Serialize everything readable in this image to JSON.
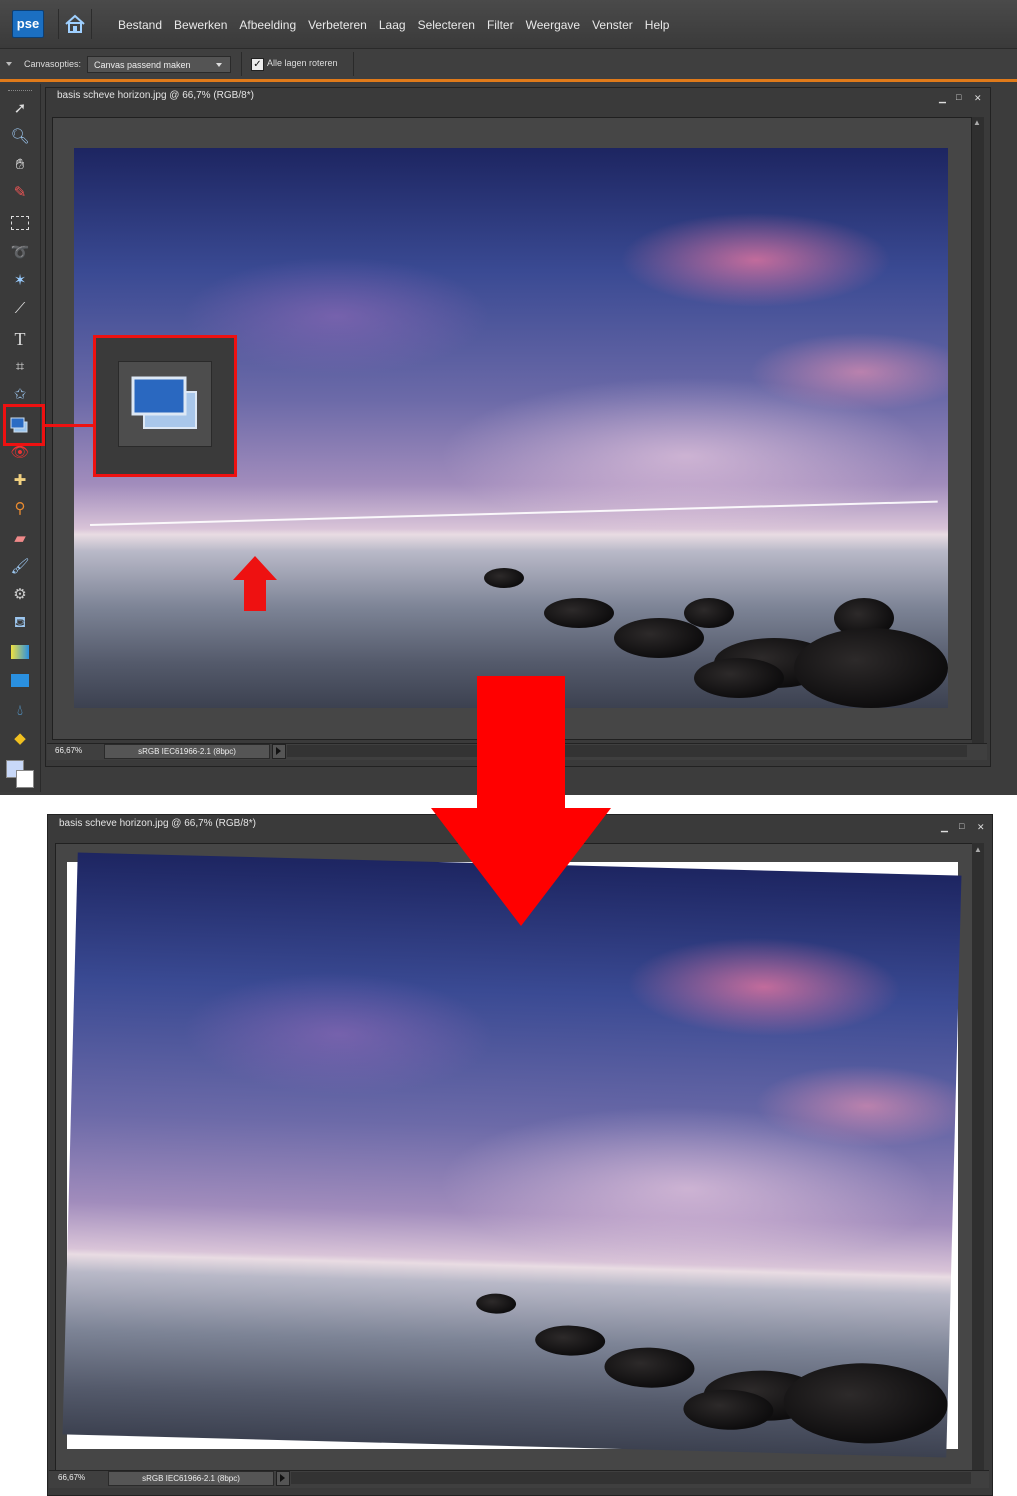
{
  "app": {
    "logo_text": "pse",
    "home_icon": "home-icon"
  },
  "menu": [
    "Bestand",
    "Bewerken",
    "Afbeelding",
    "Verbeteren",
    "Laag",
    "Selecteren",
    "Filter",
    "Weergave",
    "Venster",
    "Help"
  ],
  "options_bar": {
    "canvas_label": "Canvasopties:",
    "canvas_select_value": "Canvas passend maken",
    "rotate_all_layers_label": "Alle lagen roteren",
    "rotate_all_layers_checked": true
  },
  "tools": [
    "move-tool-icon",
    "zoom-tool-icon",
    "hand-tool-icon",
    "eyedropper-tool-icon",
    "marquee-tool-icon",
    "lasso-tool-icon",
    "magic-wand-tool-icon",
    "quick-selection-tool-icon",
    "type-tool-icon",
    "crop-tool-icon",
    "cookie-cutter-tool-icon",
    "straighten-tool-icon",
    "red-eye-tool-icon",
    "healing-brush-tool-icon",
    "clone-stamp-tool-icon",
    "eraser-tool-icon",
    "brush-tool-icon",
    "smart-brush-tool-icon",
    "paint-bucket-tool-icon",
    "gradient-tool-icon",
    "shape-tool-icon",
    "blur-tool-icon",
    "sponge-tool-icon"
  ],
  "document_before": {
    "title": "basis scheve horizon.jpg @ 66,7% (RGB/8*)",
    "zoom": "66,67%",
    "color_profile": "sRGB IEC61966-2.1 (8bpc)"
  },
  "document_after": {
    "title": "basis scheve horizon.jpg @ 66,7% (RGB/8*)",
    "zoom": "66,67%",
    "color_profile": "sRGB IEC61966-2.1 (8bpc)"
  },
  "window_controls": {
    "minimize": "▁",
    "maximize": "□",
    "close": "✕"
  },
  "colors": {
    "accent_orange": "#e07a1a",
    "annotation_red": "#ff0000"
  }
}
